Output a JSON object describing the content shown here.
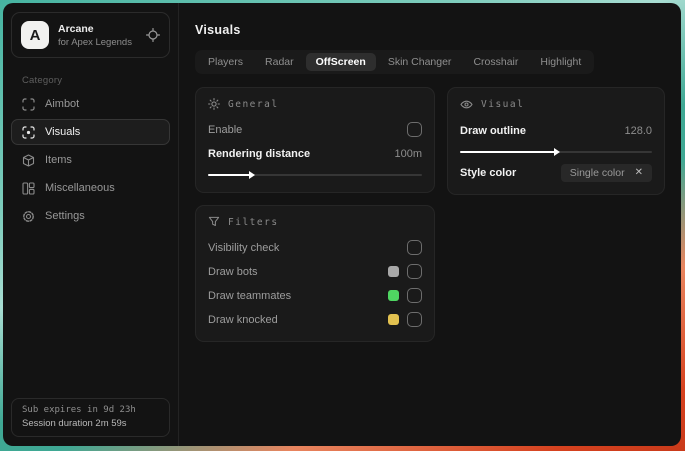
{
  "app": {
    "brand": {
      "initial": "A",
      "name": "Arcane",
      "subtitle": "for Apex Legends"
    }
  },
  "sidebar": {
    "category_label": "Category",
    "items": [
      {
        "label": "Aimbot",
        "icon": "crosshair-frame-icon",
        "active": false
      },
      {
        "label": "Visuals",
        "icon": "scan-eye-icon",
        "active": true
      },
      {
        "label": "Items",
        "icon": "package-icon",
        "active": false
      },
      {
        "label": "Miscellaneous",
        "icon": "layout-grid-icon",
        "active": false
      },
      {
        "label": "Settings",
        "icon": "gear-icon",
        "active": false
      }
    ],
    "session": {
      "sub_expires": "Sub expires in 9d 23h",
      "duration": "Session duration 2m 59s"
    }
  },
  "main": {
    "title": "Visuals",
    "tabs": [
      {
        "label": "Players",
        "active": false
      },
      {
        "label": "Radar",
        "active": false
      },
      {
        "label": "OffScreen",
        "active": true
      },
      {
        "label": "Skin Changer",
        "active": false
      },
      {
        "label": "Crosshair",
        "active": false
      },
      {
        "label": "Highlight",
        "active": false
      }
    ],
    "general_panel": {
      "header": "General",
      "icon": "sun-icon",
      "enable": {
        "label": "Enable",
        "checked": false
      },
      "rendering_distance": {
        "label": "Rendering distance",
        "value": "100m",
        "percent": 21
      }
    },
    "visual_panel": {
      "header": "Visual",
      "icon": "eye-icon",
      "draw_outline": {
        "label": "Draw outline",
        "value": "128.0",
        "percent": 51
      },
      "style_color": {
        "label": "Style color",
        "selected": "Single color",
        "clear_glyph": "✕"
      }
    },
    "filters_panel": {
      "header": "Filters",
      "icon": "funnel-icon",
      "rows": [
        {
          "label": "Visibility check",
          "checked": false
        },
        {
          "label": "Draw bots",
          "swatch": "#a8a8a8",
          "checked": false
        },
        {
          "label": "Draw teammates",
          "swatch": "#4fd662",
          "checked": false
        },
        {
          "label": "Draw knocked",
          "swatch": "#e2c150",
          "checked": false
        }
      ]
    }
  },
  "colors": {
    "window_bg": "#131313",
    "panel_bg": "#1a1a1a",
    "accent_teal": "#46b4a1",
    "accent_orange": "#d6421f"
  }
}
